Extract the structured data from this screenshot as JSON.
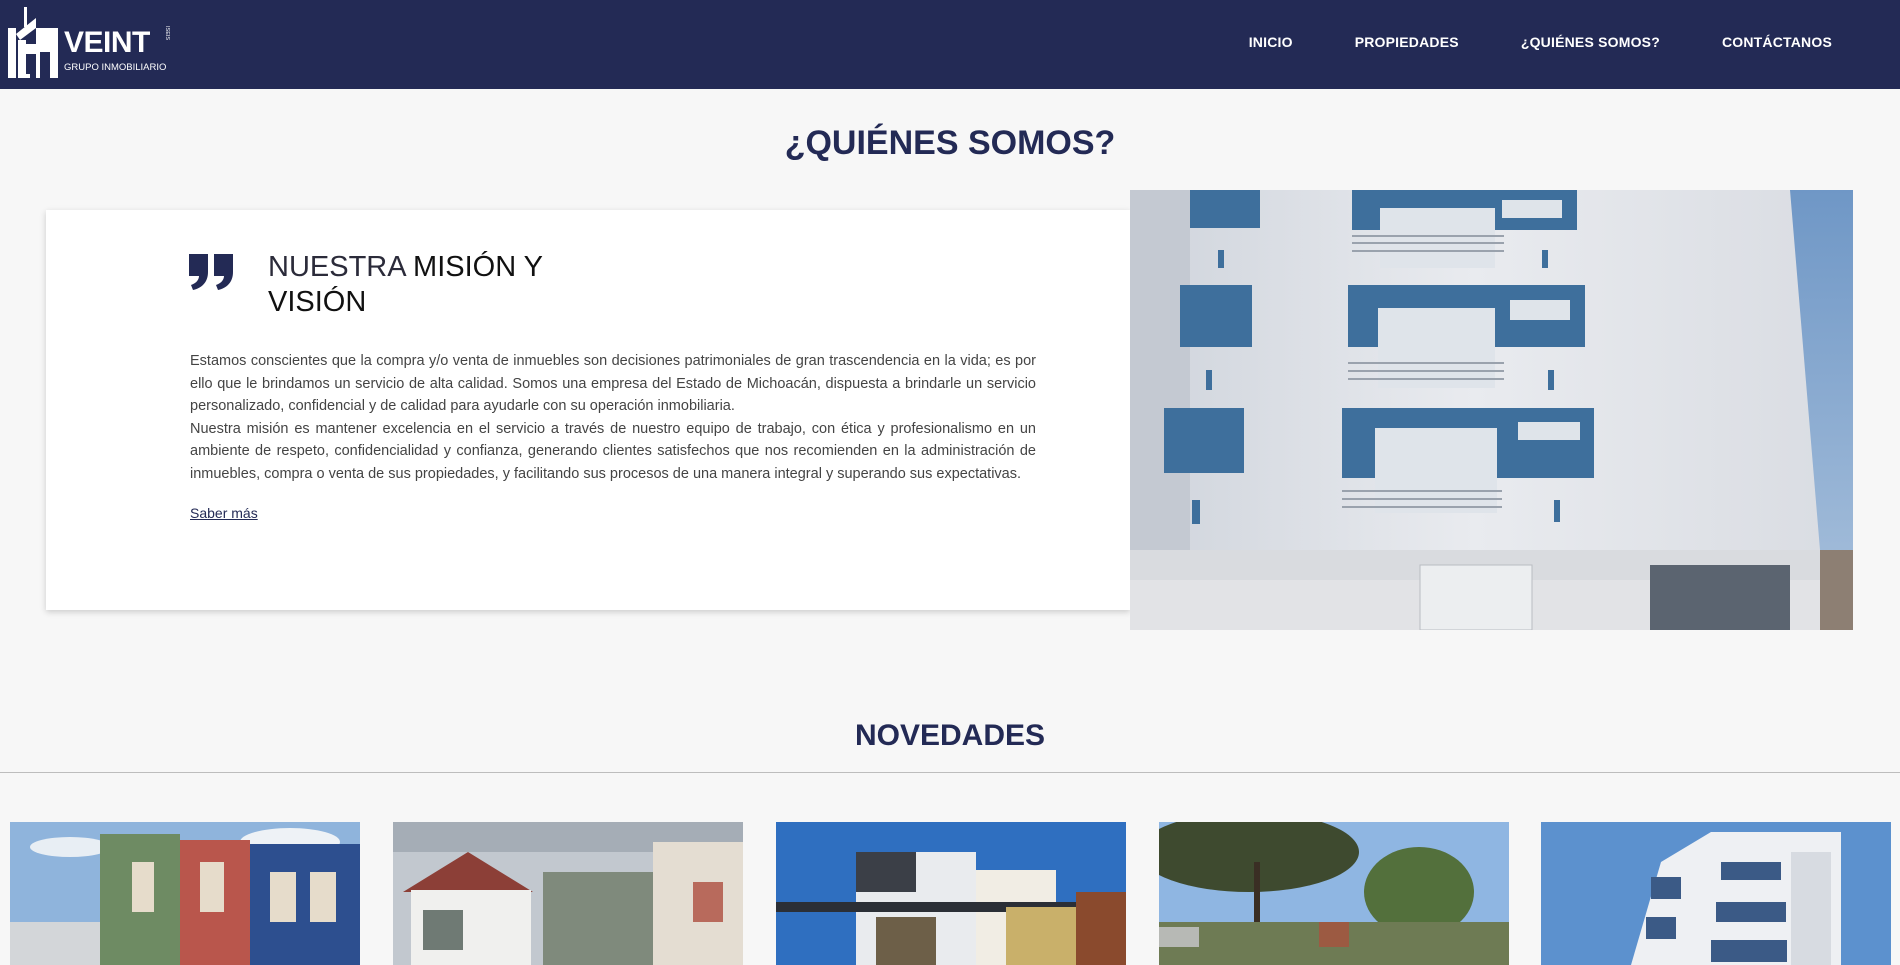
{
  "brand": {
    "logo_text": "VEINT",
    "logo_subtext": "GRUPO INMOBILIARIO",
    "logo_side": "ISEIS"
  },
  "nav": {
    "items": [
      "INICIO",
      "PROPIEDADES",
      "¿QUIÉNES SOMOS?",
      "CONTÁCTANOS"
    ]
  },
  "about": {
    "title": "¿QUIÉNES SOMOS?",
    "heading_light": "NUESTRA ",
    "heading_strong": "MISIÓN Y VISIÓN",
    "paragraph_1": "Estamos conscientes que la compra y/o venta de inmuebles son decisiones patrimoniales de gran trascendencia en la vida; es por ello que le brindamos un servicio de alta calidad. Somos una empresa del Estado de Michoacán, dispuesta a brindarle un servicio personalizado, confidencial y de calidad para ayudarle con su operación inmobiliaria.",
    "paragraph_2": "Nuestra misión es mantener excelencia en el servicio a través de nuestro equipo de trabajo, con ética y profesionalismo en un ambiente de respeto, confidencialidad y confianza, generando clientes satisfechos que nos recomienden en la administración de inmuebles, compra o venta de sus propiedades, y facilitando sus procesos de una manera integral y superando sus expectativas.",
    "link": "Saber más"
  },
  "news": {
    "title": "NOVEDADES"
  },
  "colors": {
    "navy": "#232a55",
    "background": "#f7f7f7",
    "card": "#ffffff"
  }
}
